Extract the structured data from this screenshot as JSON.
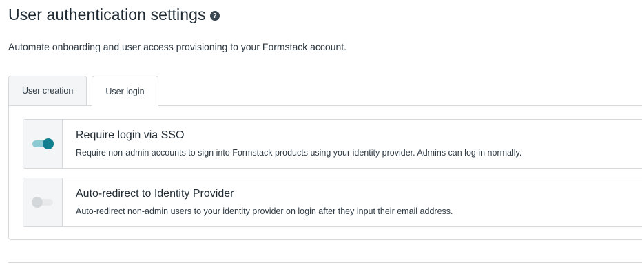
{
  "header": {
    "title": "User authentication settings",
    "help_glyph": "?",
    "subtitle": "Automate onboarding and user access provisioning to your Formstack account."
  },
  "tabs": [
    {
      "label": "User creation",
      "active": false
    },
    {
      "label": "User login",
      "active": true
    }
  ],
  "settings": [
    {
      "title": "Require login via SSO",
      "description": "Require non-admin accounts to sign into Formstack products using your identity provider. Admins can log in normally.",
      "enabled": true
    },
    {
      "title": "Auto-redirect to Identity Provider",
      "description": "Auto-redirect non-admin users to your identity provider on login after they input their email address.",
      "enabled": false
    }
  ],
  "colors": {
    "accent": "#127f91",
    "accent_track": "#8ecad3",
    "border": "#d5d9dc",
    "muted_bg": "#f4f5f6"
  }
}
